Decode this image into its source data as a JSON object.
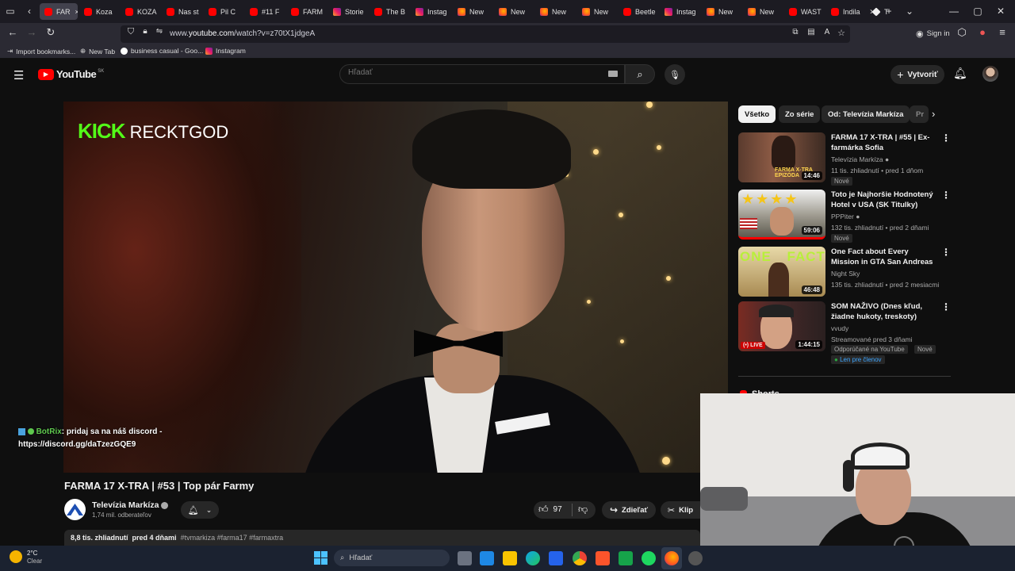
{
  "browser": {
    "tabs": [
      {
        "label": "FAR",
        "icon": "youtube-icon",
        "active": true,
        "close": "×"
      },
      {
        "label": "Koza",
        "icon": "youtube-icon"
      },
      {
        "label": "KOZA",
        "icon": "youtube-icon"
      },
      {
        "label": "Nas st",
        "icon": "youtube-icon"
      },
      {
        "label": "Pil C",
        "icon": "youtube-icon"
      },
      {
        "label": "#11 F",
        "icon": "youtube-icon"
      },
      {
        "label": "FARM",
        "icon": "youtube-icon"
      },
      {
        "label": "Storie",
        "icon": "instagram-icon"
      },
      {
        "label": "The B",
        "icon": "youtube-icon"
      },
      {
        "label": "Instag",
        "icon": "instagram-icon"
      },
      {
        "label": "New",
        "icon": "firefox-icon"
      },
      {
        "label": "New",
        "icon": "firefox-icon"
      },
      {
        "label": "New",
        "icon": "firefox-icon"
      },
      {
        "label": "New",
        "icon": "firefox-icon"
      },
      {
        "label": "Beetle",
        "icon": "youtube-icon"
      },
      {
        "label": "Instag",
        "icon": "instagram-icon"
      },
      {
        "label": "New",
        "icon": "firefox-icon"
      },
      {
        "label": "New",
        "icon": "firefox-icon"
      },
      {
        "label": "WAST",
        "icon": "youtube-icon"
      },
      {
        "label": "Indila",
        "icon": "youtube-icon"
      },
      {
        "label": "Th",
        "icon": "generic-icon"
      }
    ],
    "url_prefix": "www.",
    "url_domain": "youtube.com",
    "url_path": "/watch?v=z70tX1jdgeA",
    "sign_in": "Sign in",
    "bookmarks": [
      {
        "label": "Import bookmarks...",
        "icon": "import-icon"
      },
      {
        "label": "New Tab",
        "icon": "globe-icon"
      },
      {
        "label": "business casual - Goo...",
        "icon": "google-icon"
      },
      {
        "label": "Instagram",
        "icon": "instagram-icon"
      }
    ]
  },
  "youtube": {
    "logo": "YouTube",
    "region": "SK",
    "search_placeholder": "Hľadať",
    "create_label": "Vytvoriť",
    "video": {
      "overlay_brand": "KICK",
      "overlay_channel": "RECKTGOD",
      "chat_user": "BotRix",
      "chat_message": ": pridaj sa na náš discord -",
      "chat_link": "https://discord.gg/daTzezGQE9"
    },
    "title": "FARMA 17 X-TRA | #53 | Top pár Farmy",
    "channel": "Televízia Markíza",
    "subscribers": "1,74 mil. odberateľov",
    "likes": "97",
    "share_label": "Zdieľať",
    "clip_label": "Klip",
    "views": "8,8 tis. zhliadnutí",
    "date": "pred 4 dňami",
    "hashtags": "#tvmarkiza #farma17 #farmaxtra"
  },
  "sidebar": {
    "chips": [
      "Všetko",
      "Zo série",
      "Od: Televízia Markíza",
      "Pr"
    ],
    "recommendations": [
      {
        "title": "FARMA 17 X-TRA | #55 | Ex-farmárka Sofia",
        "channel": "Televízia Markíza",
        "verified": true,
        "meta": "11 tis. zhliadnutí • pred 1 dňom",
        "duration": "14:46",
        "badges": [
          "Nové"
        ],
        "thumb_text": "FARMA X-TRA EPIZÓDA"
      },
      {
        "title": "Toto je Najhoršie Hodnotený Hotel v USA (SK Titulky)",
        "channel": "PPPiter",
        "verified": true,
        "meta": "132 tis. zhliadnutí • pred 2 dňami",
        "duration": "59:06",
        "badges": [
          "Nové"
        ],
        "thumb_text": "★★★★"
      },
      {
        "title": "One Fact about Every Mission in GTA San Andreas",
        "channel": "Night Sky",
        "verified": false,
        "meta": "135 tis. zhliadnutí • pred 2 mesiacmi",
        "duration": "46:48",
        "badges": [],
        "thumb_text": "ONE FACT"
      },
      {
        "title": "SOM NAŽIVO (Dnes kľud, žiadne hukoty, treskoty)",
        "channel": "vvudy",
        "verified": false,
        "meta": "Streamované pred 3 dňami",
        "duration": "1:44:15",
        "live": "LIVE",
        "badges": [
          "Odporúčané na YouTube",
          "Nové"
        ],
        "member": "Len pre členov"
      }
    ],
    "shorts_label": "Shorts"
  },
  "taskbar": {
    "weather_temp": "2°C",
    "weather_desc": "Clear",
    "search_placeholder": "Hľadať"
  },
  "colors": {
    "accent": "#ff0000",
    "kick": "#53fc18",
    "chat_user": "#5ec84e",
    "member": "#3ea6ff"
  }
}
